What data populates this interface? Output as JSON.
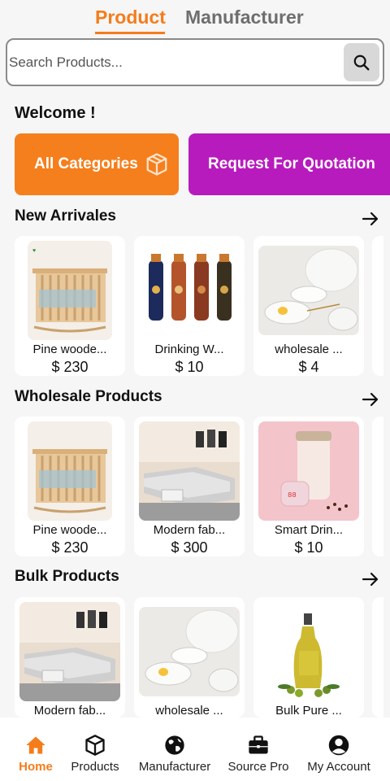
{
  "top_tabs": {
    "product": "Product",
    "manufacturer": "Manufacturer"
  },
  "search": {
    "placeholder": "Search Products..."
  },
  "welcome": "Welcome !",
  "categories": {
    "all": "All Categories",
    "rfq": "Request For Quotation"
  },
  "sections": {
    "new_arrivals": {
      "title": "New Arrivales",
      "items": [
        {
          "name": "Pine woode...",
          "price": "$ 230"
        },
        {
          "name": "Drinking W...",
          "price": "$ 10"
        },
        {
          "name": "wholesale ...",
          "price": "$ 4"
        }
      ]
    },
    "wholesale": {
      "title": "Wholesale Products",
      "items": [
        {
          "name": "Pine woode...",
          "price": "$ 230"
        },
        {
          "name": "Modern fab...",
          "price": "$ 300"
        },
        {
          "name": "Smart Drin...",
          "price": "$ 10"
        }
      ]
    },
    "bulk": {
      "title": "Bulk Products",
      "items": [
        {
          "name": "Modern fab..."
        },
        {
          "name": "wholesale ..."
        },
        {
          "name": "Bulk Pure ..."
        }
      ]
    }
  },
  "nav": {
    "home": "Home",
    "products": "Products",
    "manufacturer": "Manufacturer",
    "source_pro": "Source Pro",
    "account": "My Account"
  },
  "colors": {
    "accent": "#f57c1b",
    "rfq": "#b81bbd"
  }
}
